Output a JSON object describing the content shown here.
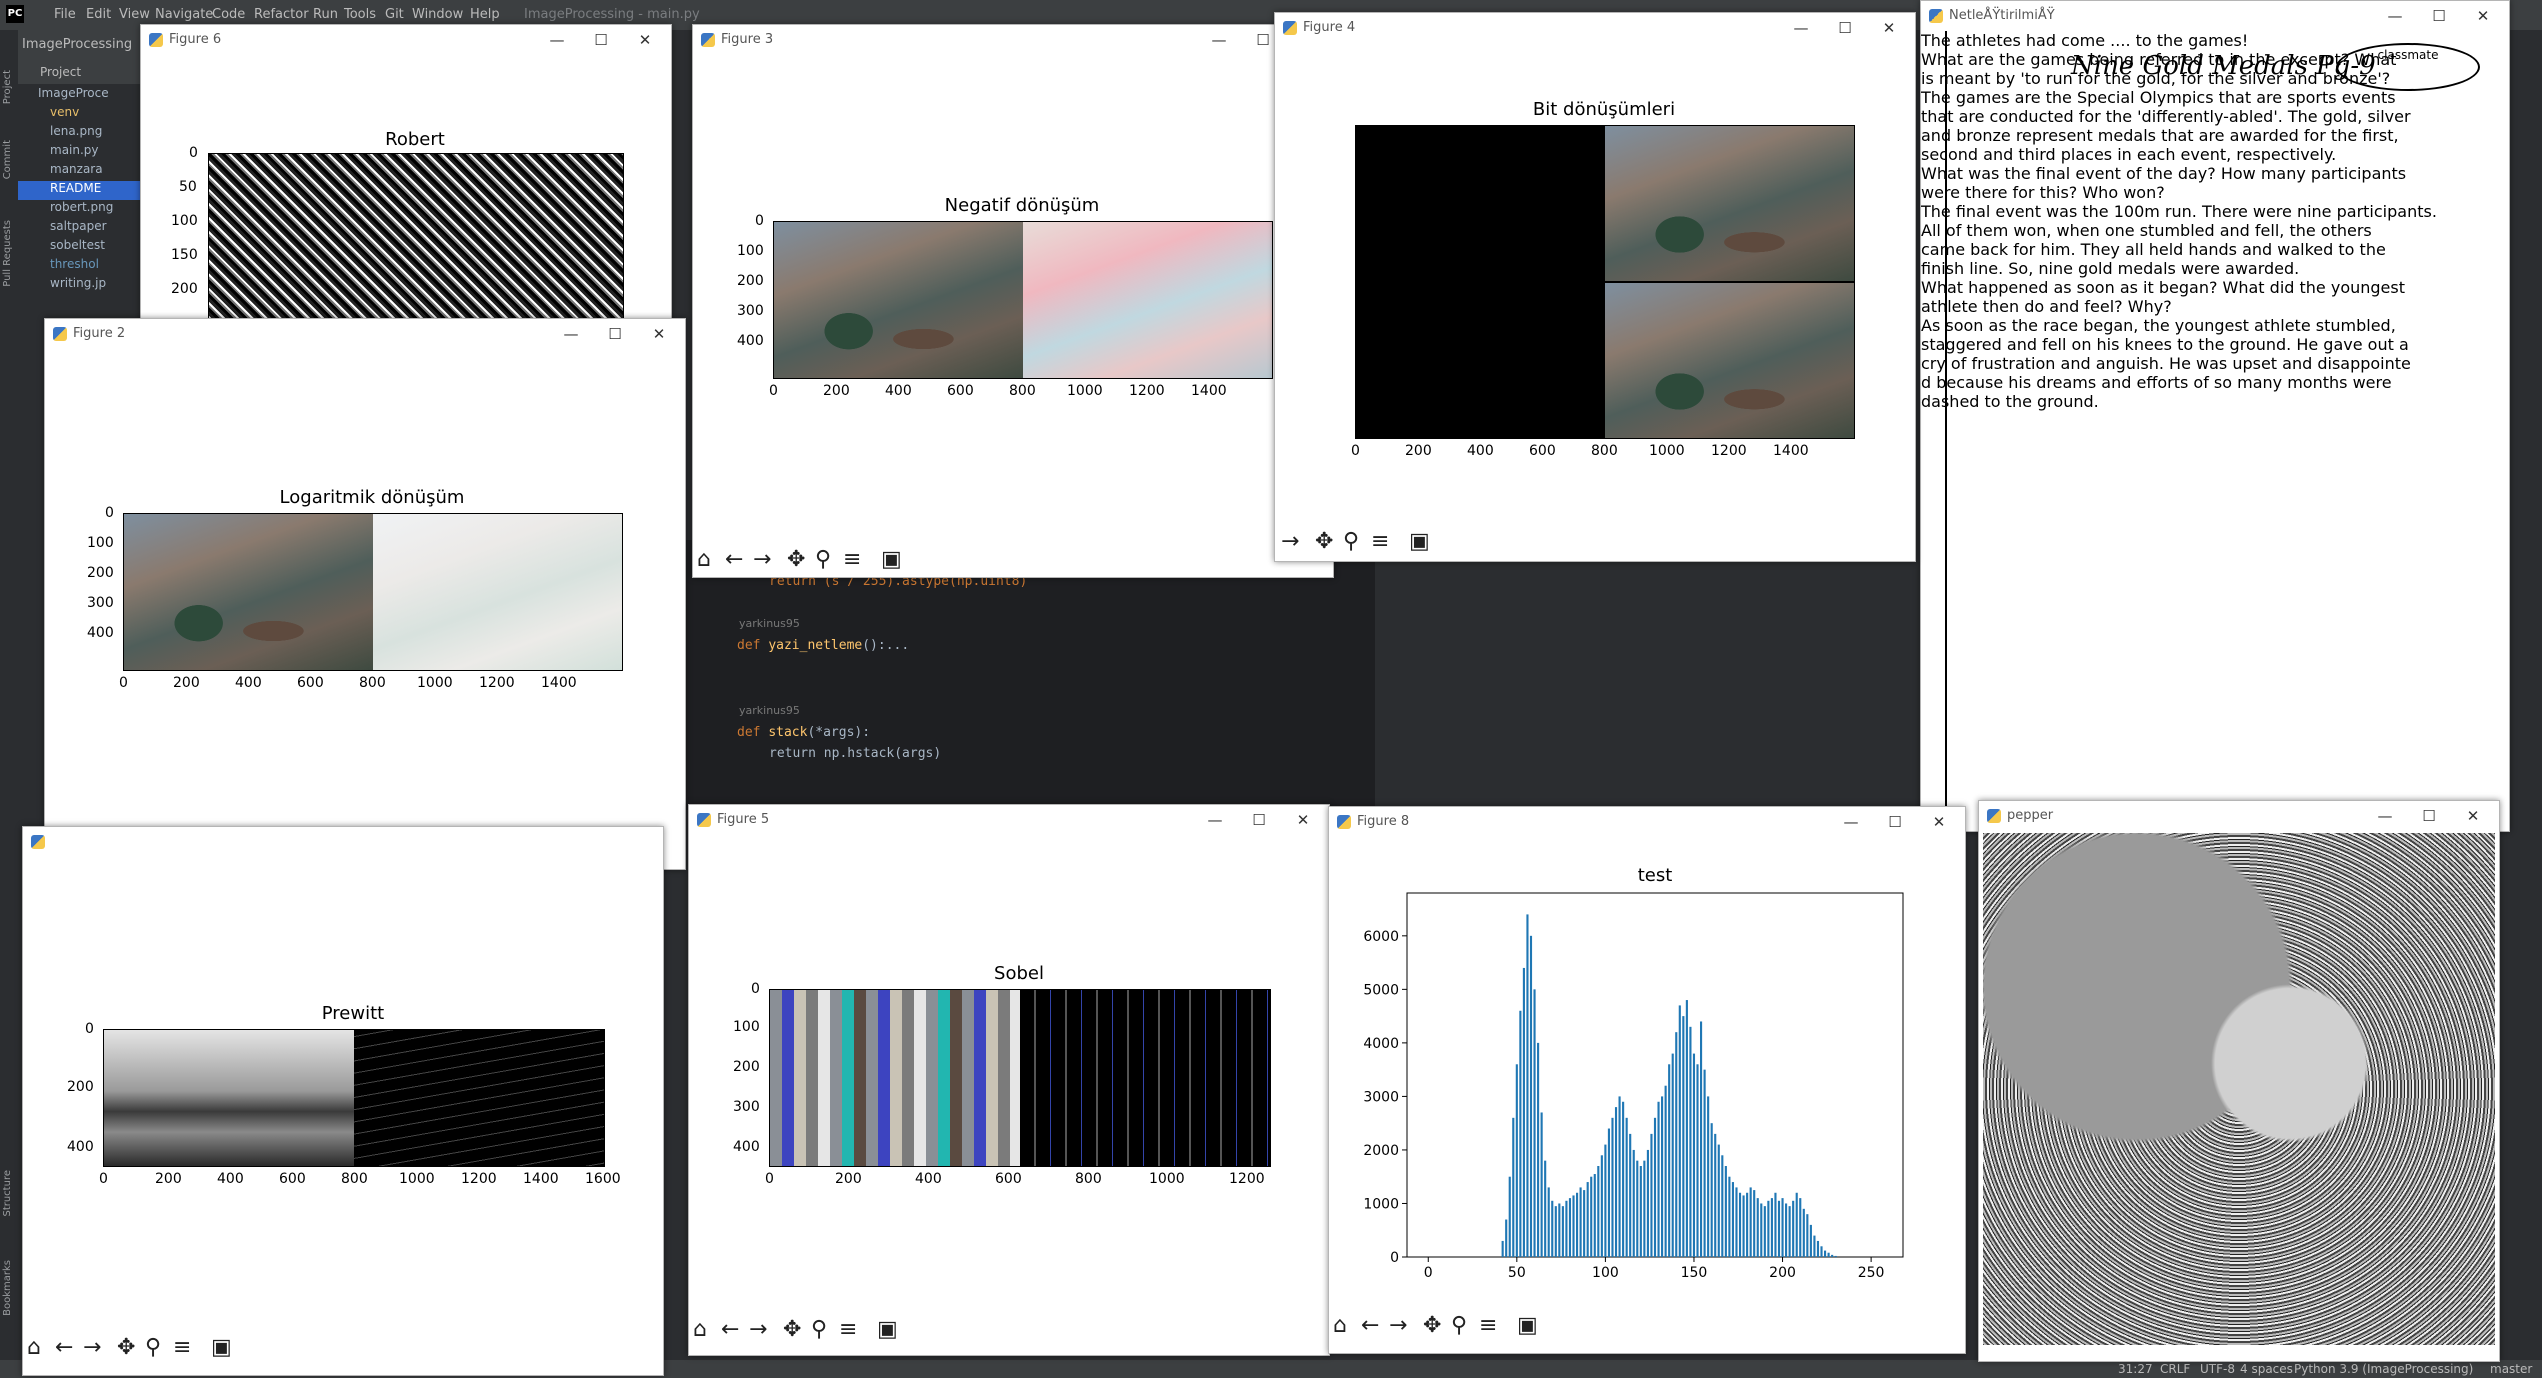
{
  "ide": {
    "menu": [
      "File",
      "Edit",
      "View",
      "Navigate",
      "Code",
      "Refactor",
      "Run",
      "Tools",
      "Git",
      "Window",
      "Help"
    ],
    "window_title": "ImageProcessing - main.py",
    "project_name": "ImageProcessing",
    "project_label": "Project",
    "side_tabs": [
      "Project",
      "Commit",
      "Pull Requests",
      "Structure",
      "Bookmarks"
    ],
    "tree": {
      "root": "ImageProce",
      "items": [
        "venv",
        "lena.png",
        "main.py",
        "manzara",
        "README",
        "robert.png",
        "saltpaper",
        "sobeltest",
        "threshol",
        "writing.jp"
      ],
      "selected_index": 4
    },
    "code": {
      "line1": "return (s / 255).astype(np.uint8)",
      "author1": "yarkinus95",
      "def1_kw": "def",
      "def1_name": "yazi_netleme",
      "def1_rest": "():...",
      "author2": "yarkinus95",
      "def2_kw": "def",
      "def2_name": "stack",
      "def2_rest": "(*args):",
      "line_ret": "return np.hstack(args)"
    },
    "status": {
      "pos": "31:27",
      "eol": "CRLF",
      "enc": "UTF-8",
      "indent": "4 spaces",
      "interp": "Python 3.9 (ImageProcessing)",
      "branch": "master"
    }
  },
  "windows": {
    "fig6": {
      "title": "Figure 6",
      "plot_title": "Robert",
      "yticks": [
        "0",
        "50",
        "100",
        "150",
        "200"
      ]
    },
    "fig3": {
      "title": "Figure 3",
      "plot_title": "Negatif dönüşüm",
      "yticks": [
        "0",
        "100",
        "200",
        "300",
        "400"
      ],
      "xticks": [
        "0",
        "200",
        "400",
        "600",
        "800",
        "1000",
        "1200",
        "1400"
      ]
    },
    "fig4": {
      "title": "Figure 4",
      "plot_title": "Bit dönüşümleri",
      "xticks": [
        "0",
        "200",
        "400",
        "600",
        "800",
        "1000",
        "1200",
        "1400"
      ]
    },
    "fig2": {
      "title": "Figure 2",
      "plot_title": "Logaritmik dönüşüm",
      "yticks": [
        "0",
        "100",
        "200",
        "300",
        "400"
      ],
      "xticks": [
        "0",
        "200",
        "400",
        "600",
        "800",
        "1000",
        "1200",
        "1400"
      ]
    },
    "fig_prewitt": {
      "plot_title": "Prewitt",
      "yticks": [
        "0",
        "200",
        "400"
      ],
      "xticks": [
        "0",
        "200",
        "400",
        "600",
        "800",
        "1000",
        "1200",
        "1400",
        "1600"
      ]
    },
    "fig5": {
      "title": "Figure 5",
      "plot_title": "Sobel",
      "yticks": [
        "0",
        "100",
        "200",
        "300",
        "400"
      ],
      "xticks": [
        "0",
        "200",
        "400",
        "600",
        "800",
        "1000",
        "1200"
      ]
    },
    "fig8": {
      "title": "Figure 8",
      "plot_title": "test",
      "yticks": [
        "0",
        "1000",
        "2000",
        "3000",
        "4000",
        "5000",
        "6000"
      ],
      "xticks": [
        "0",
        "50",
        "100",
        "150",
        "200",
        "250"
      ]
    },
    "netle": {
      "title": "NetleÅŸtirilmiÅŸ"
    },
    "pepper": {
      "title": "pepper"
    }
  },
  "toolbar_icons": [
    "home-icon",
    "back-icon",
    "forward-icon",
    "pan-icon",
    "zoom-icon",
    "configure-icon",
    "save-icon"
  ],
  "handwriting": {
    "header": "Nine Gold Medals   Pg-9",
    "classmate": "classmate",
    "lines": [
      "The athletes had come .... to the games!",
      "What are the games being referred to in the excerpt? What",
      "is meant by 'to run for the gold, for the silver and bronze'?",
      "The games are the Special Olympics that are sports events",
      "that are conducted for the 'differently-abled'. The gold, silver",
      "and bronze represent medals that are awarded for the first,",
      "second and third places in each event, respectively.",
      "What was the final event of the day? How many participants",
      "were there for this? Who won?",
      "The final event was the 100m run. There were nine participants.",
      "All of them won, when one stumbled and fell, the others",
      "came back for him. They all held hands and walked to the",
      "finish line. So, nine gold medals were awarded.",
      "What happened as soon as it began? What did the youngest",
      "athlete then do and feel? Why?",
      "As soon as the race began, the youngest athlete stumbled,",
      "staggered and fell on his knees to the ground. He gave out a",
      "cry of frustration and anguish. He was upset and disappointe",
      "d because his dreams and efforts of so many months were",
      "dashed to the ground."
    ]
  },
  "chart_data": {
    "type": "bar",
    "title": "test",
    "xlim": [
      -12,
      268
    ],
    "ylim": [
      0,
      6800
    ],
    "x": [
      42,
      44,
      46,
      48,
      50,
      52,
      54,
      56,
      58,
      60,
      62,
      64,
      66,
      68,
      70,
      72,
      74,
      76,
      78,
      80,
      82,
      84,
      86,
      88,
      90,
      92,
      94,
      96,
      98,
      100,
      102,
      104,
      106,
      108,
      110,
      112,
      114,
      116,
      118,
      120,
      122,
      124,
      126,
      128,
      130,
      132,
      134,
      136,
      138,
      140,
      142,
      144,
      146,
      148,
      150,
      152,
      154,
      156,
      158,
      160,
      162,
      164,
      166,
      168,
      170,
      172,
      174,
      176,
      178,
      180,
      182,
      184,
      186,
      188,
      190,
      192,
      194,
      196,
      198,
      200,
      202,
      204,
      206,
      208,
      210,
      212,
      214,
      216,
      218,
      220,
      222,
      224,
      226,
      228,
      230
    ],
    "values": [
      300,
      700,
      1500,
      2600,
      3600,
      4600,
      5400,
      6400,
      6000,
      5000,
      4000,
      2700,
      1800,
      1300,
      1050,
      950,
      1000,
      950,
      1050,
      1100,
      1150,
      1200,
      1300,
      1250,
      1400,
      1500,
      1550,
      1700,
      1900,
      2100,
      2400,
      2600,
      2800,
      3000,
      2900,
      2600,
      2300,
      2000,
      1800,
      1700,
      1800,
      2000,
      2300,
      2600,
      2900,
      3000,
      3200,
      3600,
      3800,
      4200,
      4700,
      4500,
      4800,
      4300,
      3800,
      3600,
      4400,
      3500,
      3000,
      2500,
      2300,
      2100,
      1900,
      1700,
      1500,
      1400,
      1300,
      1200,
      1150,
      1200,
      1300,
      1250,
      1100,
      1000,
      950,
      1050,
      1100,
      1200,
      1050,
      1100,
      1000,
      950,
      1050,
      1200,
      1100,
      900,
      800,
      600,
      400,
      300,
      200,
      120,
      80,
      40,
      20
    ]
  }
}
